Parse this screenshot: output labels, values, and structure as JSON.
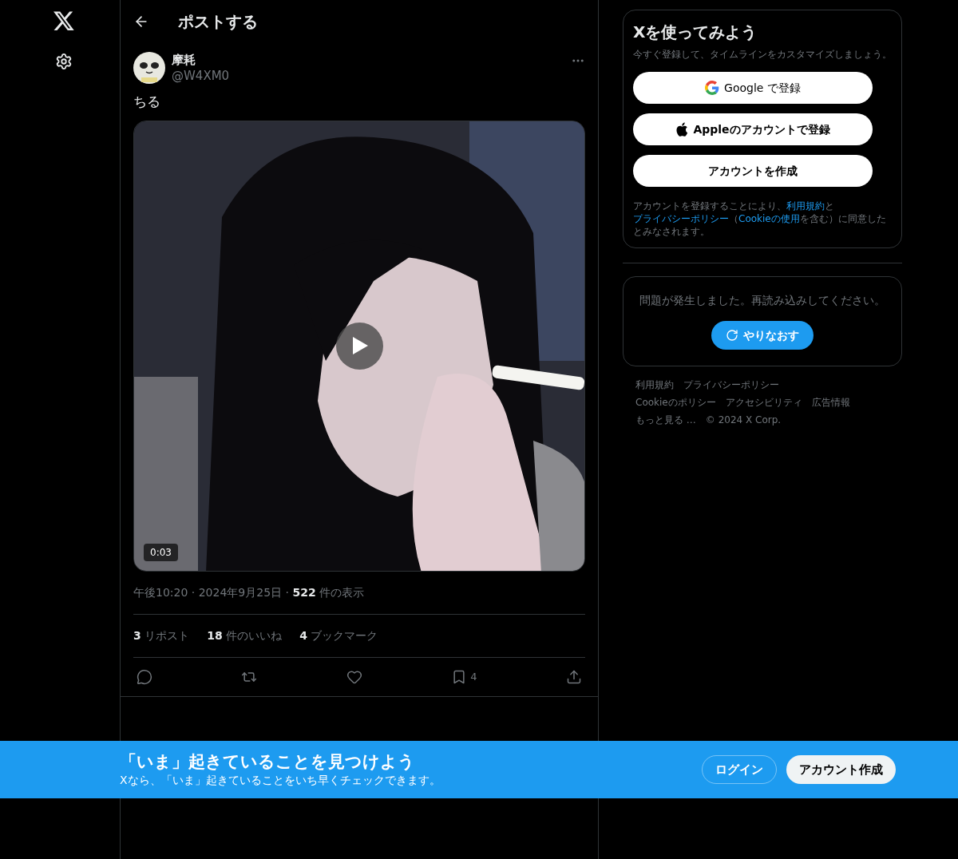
{
  "header": {
    "title": "ポストする"
  },
  "post": {
    "name": "摩耗",
    "handle": "@W4XM0",
    "text": "ちる",
    "video": {
      "duration": "0:03"
    },
    "meta": "午後10:20 · 2024年9月25日 · **522** 件の表示",
    "stats": [
      "**3** リポスト",
      "**18** 件のいいね",
      "**4** ブックマーク"
    ],
    "actions": [
      {
        "kind": "reply"
      },
      {
        "kind": "repost"
      },
      {
        "kind": "like"
      },
      {
        "kind": "bookmark",
        "count": "4"
      },
      {
        "kind": "share"
      }
    ]
  },
  "signup": {
    "title": "Xを使ってみよう",
    "subtitle": "今すぐ登録して、タイムラインをカスタマイズしましょう。",
    "buttons": [
      {
        "kind": "google",
        "label": "Google で登録"
      },
      {
        "kind": "apple",
        "label": "Appleのアカウントで登録"
      },
      {
        "kind": "plain",
        "label": "アカウントを作成"
      }
    ],
    "legal": [
      {
        "text": "アカウントを登録することにより、",
        "link": false
      },
      {
        "text": "利用規約",
        "link": true
      },
      {
        "text": "と",
        "link": false
      },
      {
        "text": "プライバシーポリシー",
        "link": true
      },
      {
        "text": "（",
        "link": false
      },
      {
        "text": "Cookieの使用",
        "link": true
      },
      {
        "text": "を含む）に同意したとみなされます。",
        "link": false
      }
    ]
  },
  "error": {
    "message": "問題が発生しました。再読み込みしてください。",
    "retry": "やりなおす"
  },
  "footer_links": [
    [
      "利用規約",
      "プライバシーポリシー"
    ],
    [
      "Cookieのポリシー",
      "アクセシビリティ",
      "広告情報"
    ],
    [
      "もっと見る …",
      "© 2024 X Corp."
    ]
  ],
  "banner": {
    "title": "「いま」起きていることを見つけよう",
    "subtitle": "Xなら、「いま」起きていることをいち早くチェックできます。",
    "login": "ログイン",
    "signup": "アカウント作成"
  }
}
